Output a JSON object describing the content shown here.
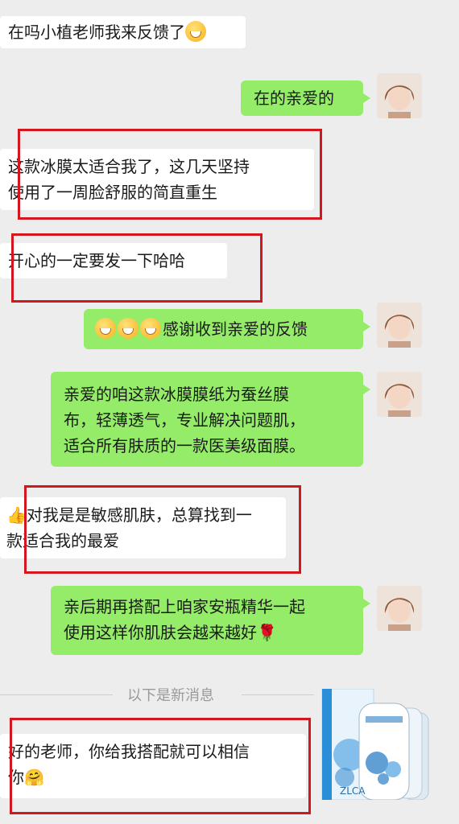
{
  "messages": [
    {
      "side": "left",
      "text": "在吗小植老师我来反馈了",
      "emoji_after": "grinning-emoji"
    },
    {
      "side": "right",
      "text": "在的亲爱的"
    },
    {
      "side": "left",
      "lines": [
        "这款冰膜太适合我了，这几天坚持",
        "使用了一周脸舒服的简直重生"
      ]
    },
    {
      "side": "left",
      "text": "开心的一定要发一下哈哈"
    },
    {
      "side": "right",
      "text": "感谢收到亲爱的反馈",
      "emoji_before": [
        "smile-emoji",
        "smile-emoji",
        "smile-emoji"
      ]
    },
    {
      "side": "right",
      "lines": [
        "亲爱的咱这款冰膜膜纸为蚕丝膜",
        "布，轻薄透气，专业解决问题肌，",
        "适合所有肤质的一款医美级面膜。"
      ]
    },
    {
      "side": "left",
      "lines": [
        "对我是是敏感肌肤，总算找到一",
        "款适合我的最爱"
      ],
      "emoji_before": "thumbs-up-emoji"
    },
    {
      "side": "right",
      "lines": [
        "亲后期再搭配上咱家安瓶精华一起",
        "使用这样你肌肤会越来越好"
      ],
      "emoji_after": "rose-emoji"
    },
    {
      "side": "left",
      "lines": [
        "好的老师，你给我搭配就可以相信",
        "你"
      ],
      "emoji_after": "hug-emoji"
    }
  ],
  "divider_text": "以下是新消息",
  "product_label": "ZLCA"
}
